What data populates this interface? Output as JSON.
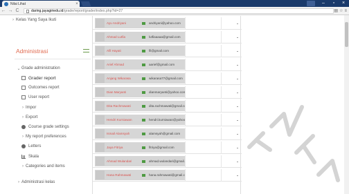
{
  "browser": {
    "tab_title": "Nilai Lihat",
    "tab_close": "×",
    "back": "←",
    "forward": "→",
    "reload": "C",
    "url_host": "daring.jayagiriedu.id",
    "url_path": "/grade/report/grader/index.php?id=27",
    "win_minimize": "–",
    "win_maximize": "▫",
    "win_close": "×",
    "ext_icon": "▤",
    "star_icon": "☆",
    "menu_icon": "≡"
  },
  "sidebar": {
    "top_item": "Kelas Yang Saya Ikuti",
    "section_title": "Administrasi",
    "grade_admin": "Grade administration",
    "items": [
      {
        "label": "Grader report",
        "icon": "grid-icon",
        "active": true
      },
      {
        "label": "Outcomes report",
        "icon": "grid-icon"
      },
      {
        "label": "User report",
        "icon": "grid-icon"
      },
      {
        "label": "Impor",
        "icon": "chevron-right-icon"
      },
      {
        "label": "Export",
        "icon": "chevron-right-icon"
      },
      {
        "label": "Course grade settings",
        "icon": "gear-icon"
      },
      {
        "label": "My report preferences",
        "icon": "chevron-right-icon"
      },
      {
        "label": "Letters",
        "icon": "gear-icon"
      },
      {
        "label": "Skala",
        "icon": "chart-icon"
      },
      {
        "label": "Categories and items",
        "icon": "chevron-right-icon"
      }
    ],
    "bottom_item": "Administrasi kelas"
  },
  "grader": {
    "rows": [
      {
        "name": "Ayu Andriyani",
        "email": "andriyani@yahoo.com"
      },
      {
        "name": "Ahmad Lutfia",
        "email": "lutfiaaaaa@gmail.com"
      },
      {
        "name": "Afil Hayati",
        "email": "fil@gmail.com"
      },
      {
        "name": "Arief Ahmad",
        "email": "aarief@gmail.com"
      },
      {
        "name": "Anjang Wikarasa",
        "email": "wikarasa77@gmail.com"
      },
      {
        "name": "Dian Maryanti",
        "email": "dianmaryanti@yahoo.com"
      },
      {
        "name": "Dita Rachmawati",
        "email": "dita.rachmawati@gmail.com"
      },
      {
        "name": "Hendri Kurniawan",
        "email": "hendri.kurniawan@yahoo.com"
      },
      {
        "name": "Ismail Alamsyah",
        "email": "alamsyah@gmail.com"
      },
      {
        "name": "Jaya Fitriya",
        "email": "fitriya@gmail.com"
      },
      {
        "name": "Ahmad Wulandari",
        "email": "ahmad.wulandari@gmail.com"
      },
      {
        "name": "Hana Rahmawati",
        "email": "hana.rahmawati@gmail.com"
      }
    ]
  },
  "colors": {
    "accent": "#e06a4f",
    "name_red": "#d9534f",
    "mail_green": "#4e9a42",
    "browser_chrome": "#1a3a6b"
  }
}
